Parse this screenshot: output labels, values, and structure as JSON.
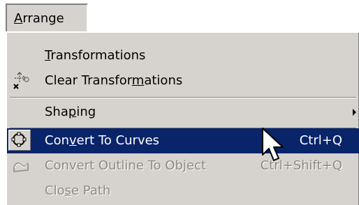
{
  "menubar": {
    "arrange_label": "Arrange",
    "arrange_mnemonic": "A",
    "arrange_rest": "rrange"
  },
  "menu": {
    "transformations": {
      "mnemonic": "T",
      "rest": "ransformations"
    },
    "clear_transformations": {
      "before": "Clear Transfor",
      "mnemonic": "m",
      "after": "ations",
      "icon": "clear-transformations-icon"
    },
    "shaping": {
      "before": "Sha",
      "mnemonic": "p",
      "after": "ing"
    },
    "convert_to_curves": {
      "before": "Con",
      "mnemonic": "v",
      "after": "ert To Curves",
      "shortcut": "Ctrl+Q",
      "icon": "convert-to-curves-icon"
    },
    "convert_outline": {
      "before": "Convert Outline To Ob",
      "mnemonic": "j",
      "after": "ect",
      "shortcut": "Ctrl+Shift+Q",
      "icon": "convert-outline-icon"
    },
    "close_path": {
      "before": "Clo",
      "mnemonic": "s",
      "after": "e Path"
    }
  },
  "colors": {
    "menu_bg": "#d6d3ce",
    "highlight_bg": "#0a246a",
    "disabled_text": "#8c8a86"
  }
}
